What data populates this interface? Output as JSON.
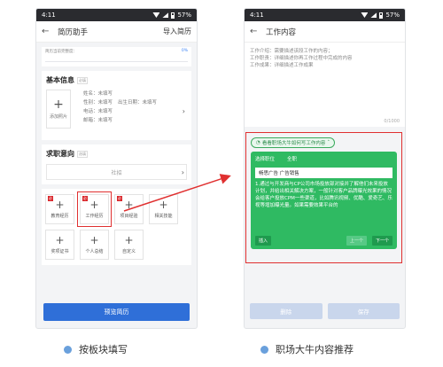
{
  "left_phone": {
    "status": {
      "time": "4:11",
      "battery": "57%"
    },
    "appbar": {
      "back": "←",
      "title": "简历助手",
      "action": "导入简历"
    },
    "progress": {
      "text": "简历当前完整度：",
      "percent": "0%"
    },
    "basic_info": {
      "title": "基本信息",
      "tag": "必填",
      "add_photo": "添加照片",
      "name": "姓名：未填写",
      "gender": "性别：未填写",
      "birth": "出生日期：未填写",
      "phone": "电话：未填写",
      "email": "邮箱：未填写"
    },
    "intent": {
      "title": "求职意向",
      "tag": "选填",
      "placeholder": "社招"
    },
    "tiles": [
      {
        "label": "教育经历",
        "required": true
      },
      {
        "label": "工作经历",
        "required": true
      },
      {
        "label": "项目经验",
        "required": true
      },
      {
        "label": "相关技能",
        "required": false
      },
      {
        "label": "奖项证书",
        "required": false
      },
      {
        "label": "个人总结",
        "required": false
      },
      {
        "label": "自定义",
        "required": false
      }
    ],
    "required_tag": "必",
    "preview_button": "预览简历"
  },
  "right_phone": {
    "status": {
      "time": "4:11",
      "battery": "57%"
    },
    "appbar": {
      "back": "←",
      "title": "工作内容"
    },
    "hints": [
      "工作介绍：需要描述该段工作的内容；",
      "工作职责：详细描述你再工作过程中完成的内容",
      "工作成果：详细描述工作成果"
    ],
    "counter": "0/1000",
    "tip_pill": "看看职场大牛如何写工作内容",
    "card": {
      "select_position": "选择职位",
      "all": "全职",
      "position": "畅思广告 广告销售",
      "body": "1.通过与开发商与CP公司市场投放部对接并了解他们未来投放计划，并给出相关解决方案，一般针对客户品牌曝光效果的情况会给客户投放CPM一些渠道，比如腾讯视频、优酷、爱奇艺、乐视等增加曝光量。如果需要效果平台的",
      "insert": "插入",
      "prev": "上一个",
      "next": "下一个"
    },
    "delete_button": "删除",
    "save_button": "保存"
  },
  "captions": {
    "left": "按板块填写",
    "right": "职场大牛内容推荐"
  },
  "colors": {
    "primary": "#2f6fd8",
    "green": "#2fba62",
    "highlight": "#e03030",
    "dot": "#6aa0dc"
  }
}
